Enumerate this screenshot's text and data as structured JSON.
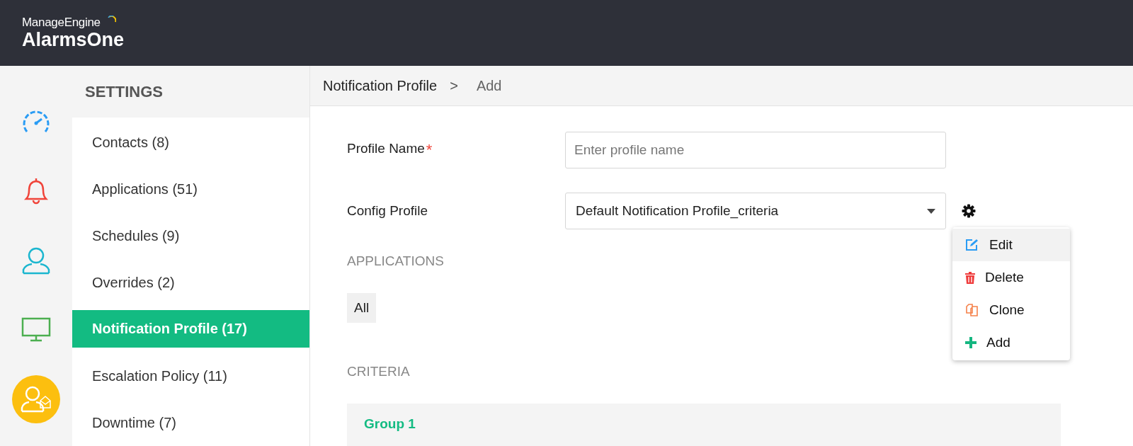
{
  "header": {
    "brand": "ManageEngine",
    "product": "AlarmsOne"
  },
  "rail": [
    {
      "kind": "dashboard",
      "selected": false
    },
    {
      "kind": "alarms",
      "selected": false
    },
    {
      "kind": "users",
      "selected": false
    },
    {
      "kind": "monitors",
      "selected": false
    },
    {
      "kind": "contacts",
      "selected": true
    }
  ],
  "sidebar": {
    "title": "SETTINGS",
    "items": [
      {
        "label": "Contacts (8)",
        "selected": false
      },
      {
        "label": "Applications (51)",
        "selected": false
      },
      {
        "label": "Schedules (9)",
        "selected": false
      },
      {
        "label": "Overrides (2)",
        "selected": false
      },
      {
        "label": "Notification Profile (17)",
        "selected": true
      },
      {
        "label": "Escalation Policy (11)",
        "selected": false
      },
      {
        "label": "Downtime (7)",
        "selected": false
      }
    ]
  },
  "breadcrumb": {
    "parent": "Notification Profile",
    "separator": ">",
    "current": "Add"
  },
  "form": {
    "profile_name": {
      "label": "Profile Name",
      "required_mark": "*",
      "placeholder": "Enter profile name"
    },
    "config_profile": {
      "label": "Config Profile",
      "value": "Default Notification Profile_criteria"
    },
    "applications": {
      "heading": "APPLICATIONS",
      "chip": "All"
    },
    "criteria": {
      "heading": "CRITERIA",
      "group": "Group 1"
    }
  },
  "config_menu": [
    {
      "kind": "edit",
      "label": "Edit",
      "selected": true
    },
    {
      "kind": "delete",
      "label": "Delete",
      "selected": false
    },
    {
      "kind": "clone",
      "label": "Clone",
      "selected": false
    },
    {
      "kind": "add",
      "label": "Add",
      "selected": false
    }
  ]
}
